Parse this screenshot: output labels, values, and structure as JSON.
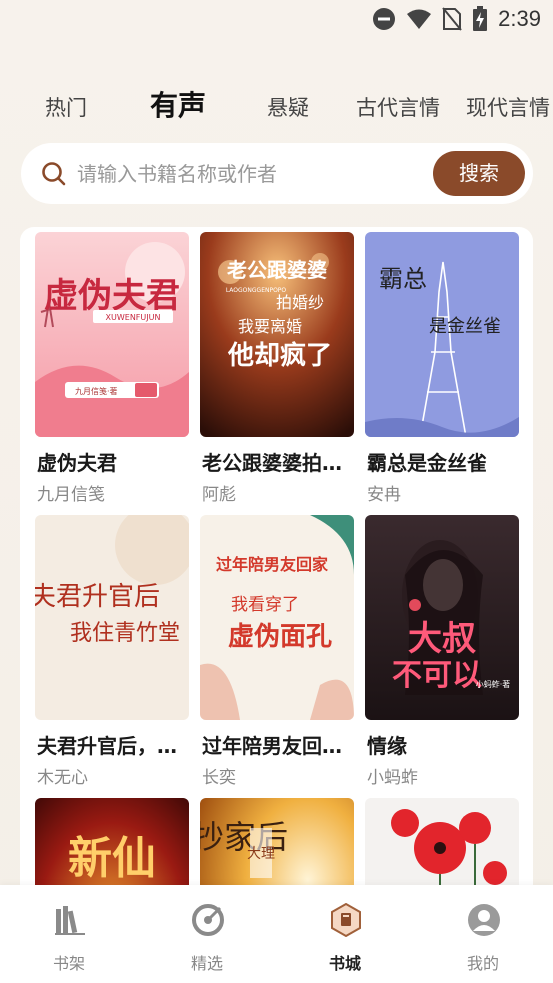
{
  "status_bar": {
    "time": "2:39"
  },
  "tabs": [
    {
      "label": "热门",
      "active": false
    },
    {
      "label": "有声",
      "active": true
    },
    {
      "label": "悬疑",
      "active": false
    },
    {
      "label": "古代言情",
      "active": false
    },
    {
      "label": "现代言情",
      "active": false
    }
  ],
  "search": {
    "placeholder": "请输入书籍名称或作者",
    "button_label": "搜索"
  },
  "books": [
    {
      "title": "虚伪夫君",
      "author": "九月信笺",
      "cover_text": "虚伪夫君",
      "cover_sub": "XUWENFUJUN",
      "cover_author": "九月信笺·著"
    },
    {
      "title": "老公跟婆婆拍婚纱我要离婚他却疯了",
      "author": "阿彪",
      "cover_text": "老公跟婆婆",
      "cover_text2": "拍婚纱",
      "cover_text3": "我要离婚",
      "cover_text4": "他却疯了",
      "cover_sub": "LAOGONGGENPOPO"
    },
    {
      "title": "霸总是金丝雀",
      "author": "安冉",
      "cover_text": "霸总",
      "cover_text2": "是金丝雀"
    },
    {
      "title": "夫君升官后，我住青竹堂",
      "author": "木无心",
      "cover_text": "夫君升官后",
      "cover_text2": "我住青竹堂"
    },
    {
      "title": "过年陪男友回家我看穿了虚伪面孔",
      "author": "长奕",
      "cover_text": "过年陪男友回家",
      "cover_text2": "我看穿了",
      "cover_text3": "虚伪面孔"
    },
    {
      "title": "情缘",
      "author": "小蚂蚱",
      "cover_text": "大叔",
      "cover_text2": "不可以",
      "cover_author": "小蚂蚱·著"
    },
    {
      "title": "",
      "author": "",
      "cover_text": "新仙"
    },
    {
      "title": "",
      "author": "",
      "cover_text": "抄家后",
      "cover_text2": "大理"
    },
    {
      "title": "",
      "author": ""
    }
  ],
  "bottom_nav": [
    {
      "label": "书架",
      "icon": "bookshelf-icon",
      "active": false
    },
    {
      "label": "精选",
      "icon": "featured-icon",
      "active": false
    },
    {
      "label": "书城",
      "icon": "bookstore-icon",
      "active": true
    },
    {
      "label": "我的",
      "icon": "profile-icon",
      "active": false
    }
  ],
  "colors": {
    "accent": "#8a4a2a",
    "background": "#f6f1ea",
    "active_nav": "#a0603a"
  }
}
